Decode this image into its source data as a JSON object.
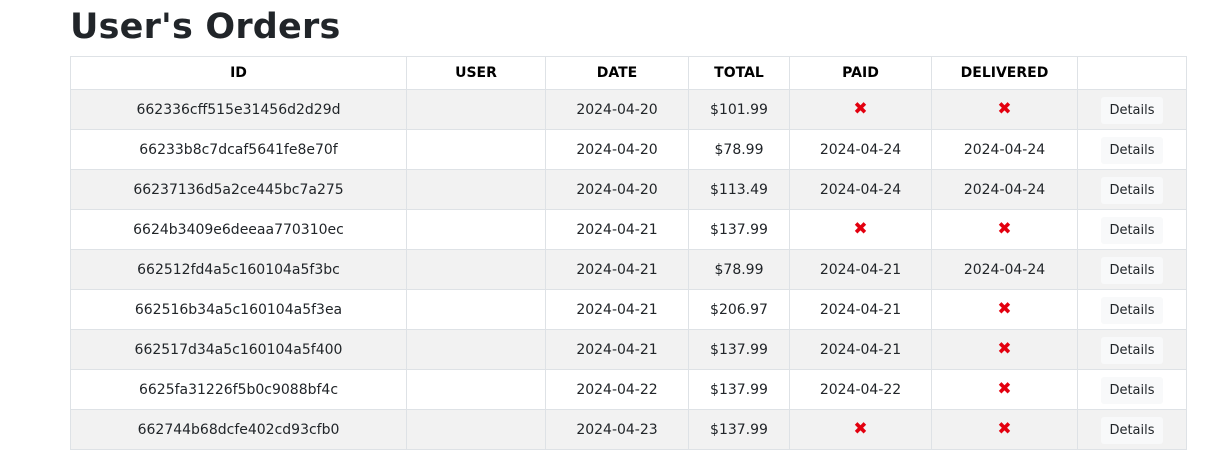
{
  "page": {
    "title": "User's Orders"
  },
  "table": {
    "headers": [
      "ID",
      "USER",
      "DATE",
      "TOTAL",
      "PAID",
      "DELIVERED",
      ""
    ],
    "details_label": "Details",
    "not_done_mark": "✖",
    "rows": [
      {
        "id": "662336cff515e31456d2d29d",
        "user": "",
        "date": "2024-04-20",
        "total": "$101.99",
        "paid": null,
        "delivered": null
      },
      {
        "id": "66233b8c7dcaf5641fe8e70f",
        "user": "",
        "date": "2024-04-20",
        "total": "$78.99",
        "paid": "2024-04-24",
        "delivered": "2024-04-24"
      },
      {
        "id": "66237136d5a2ce445bc7a275",
        "user": "",
        "date": "2024-04-20",
        "total": "$113.49",
        "paid": "2024-04-24",
        "delivered": "2024-04-24"
      },
      {
        "id": "6624b3409e6deeaa770310ec",
        "user": "",
        "date": "2024-04-21",
        "total": "$137.99",
        "paid": null,
        "delivered": null
      },
      {
        "id": "662512fd4a5c160104a5f3bc",
        "user": "",
        "date": "2024-04-21",
        "total": "$78.99",
        "paid": "2024-04-21",
        "delivered": "2024-04-24"
      },
      {
        "id": "662516b34a5c160104a5f3ea",
        "user": "",
        "date": "2024-04-21",
        "total": "$206.97",
        "paid": "2024-04-21",
        "delivered": null
      },
      {
        "id": "662517d34a5c160104a5f400",
        "user": "",
        "date": "2024-04-21",
        "total": "$137.99",
        "paid": "2024-04-21",
        "delivered": null
      },
      {
        "id": "6625fa31226f5b0c9088bf4c",
        "user": "",
        "date": "2024-04-22",
        "total": "$137.99",
        "paid": "2024-04-22",
        "delivered": null
      },
      {
        "id": "662744b68dcfe402cd93cfb0",
        "user": "",
        "date": "2024-04-23",
        "total": "$137.99",
        "paid": null,
        "delivered": null
      }
    ]
  },
  "colors": {
    "not_done_mark": "#e3000f",
    "stripe": "#f2f2f2",
    "border": "#dee2e6"
  }
}
